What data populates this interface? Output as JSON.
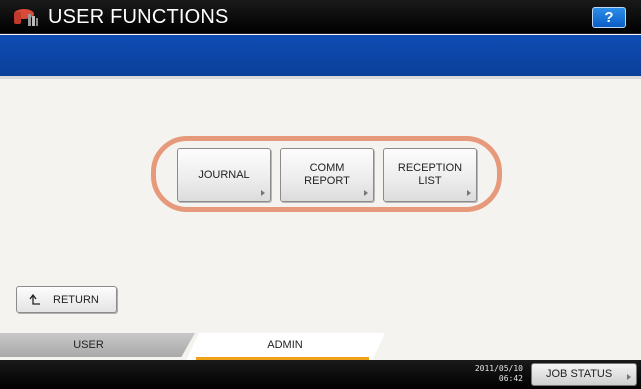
{
  "header": {
    "title": "USER FUNCTIONS",
    "help_label": "?",
    "title_icon": "user-functions-icon"
  },
  "functions": [
    {
      "label": "JOURNAL"
    },
    {
      "label": "COMM\nREPORT"
    },
    {
      "label": "RECEPTION\nLIST"
    }
  ],
  "return_button": {
    "label": "RETURN",
    "icon": "return-arrow-icon"
  },
  "tabs": [
    {
      "label": "USER",
      "active": false
    },
    {
      "label": "ADMIN",
      "active": true
    }
  ],
  "status": {
    "date": "2011/05/10",
    "time": "06:42",
    "job_status_label": "JOB STATUS"
  },
  "colors": {
    "title_bar": "#000000",
    "blue_bar": "#0f4db5",
    "highlight_ring": "#e79a7b",
    "active_tab_underline": "#f0a11a"
  }
}
